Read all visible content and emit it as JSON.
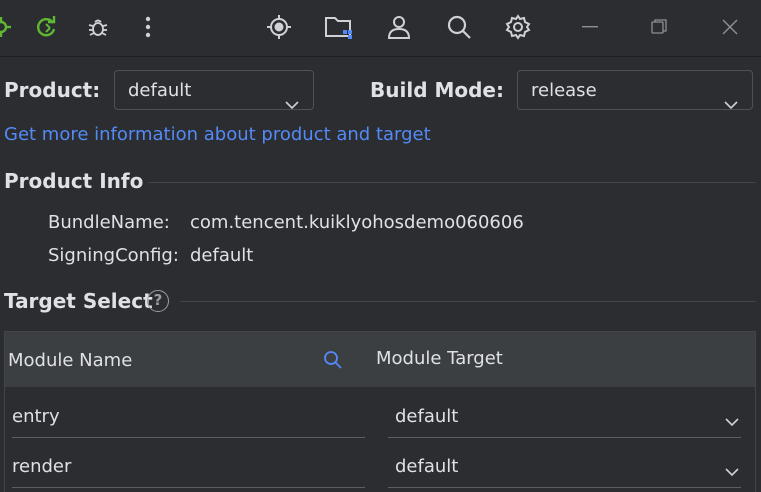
{
  "toolbar": {
    "icons": [
      "bug-gear-icon",
      "refresh-icon",
      "debug-icon",
      "more-vertical-icon",
      "target-icon",
      "project-folder-icon",
      "account-icon",
      "search-icon",
      "settings-icon",
      "minimize-icon",
      "restore-icon",
      "close-icon"
    ]
  },
  "form": {
    "product_label": "Product:",
    "product_value": "default",
    "build_mode_label": "Build Mode:",
    "build_mode_value": "release"
  },
  "info_link": "Get more information about product and target",
  "product_info": {
    "title": "Product Info",
    "bundle_name_key": "BundleName:",
    "bundle_name_value": "com.tencent.kuiklyohosdemo060606",
    "signing_key": "SigningConfig:",
    "signing_value": "default"
  },
  "target_select": {
    "title": "Target Select",
    "help_glyph": "?",
    "columns": [
      "Module Name",
      "Module Target"
    ],
    "rows": [
      {
        "module": "entry",
        "target": "default"
      },
      {
        "module": "render",
        "target": "default"
      }
    ]
  },
  "colors": {
    "background": "#2b2d30",
    "link": "#548af7",
    "accent_green": "#5fb832",
    "header_bg": "#3c3f41"
  }
}
